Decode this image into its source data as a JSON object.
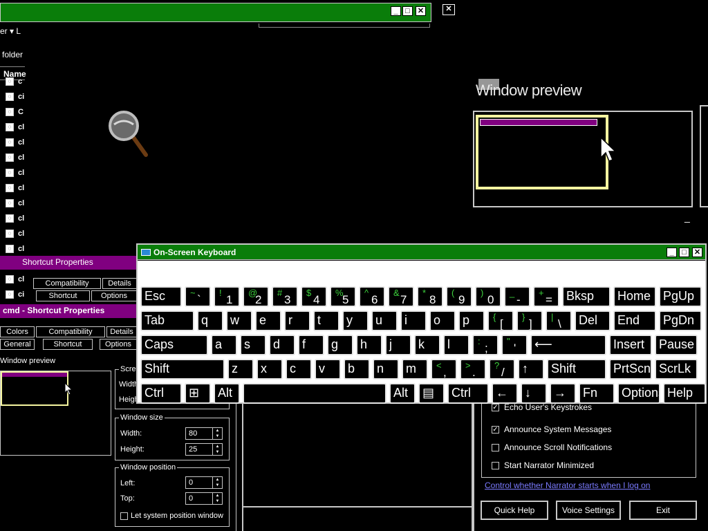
{
  "explorer": {
    "toolbar_text": "er ▾  L",
    "folder_label": "folder",
    "column_name": "Name",
    "file_items": [
      "c",
      "ci",
      "C",
      "cl",
      "cl",
      "cl",
      "cl",
      "cl",
      "cl",
      "cl",
      "cl",
      "cl",
      "cl",
      "cl",
      "ci"
    ]
  },
  "magnifier_preview": {
    "title": "Window preview",
    "min_label": "_"
  },
  "props1": {
    "title": "Shortcut Properties",
    "tabs_row1": [
      "Compatibility",
      "Details"
    ],
    "tabs_row2": [
      "Shortcut",
      "Options"
    ]
  },
  "props2": {
    "title": "cmd - Shortcut Properties",
    "tabs_row1": [
      "Colors",
      "Compatibility",
      "Details"
    ],
    "tabs_row2": [
      "General",
      "Shortcut",
      "Options"
    ],
    "preview_label": "Window preview",
    "screen_group": "Scre",
    "screen_width_label": "Width",
    "screen_height_label": "Height",
    "window_size": {
      "label": "Window size",
      "width_label": "Width:",
      "width_value": "80",
      "height_label": "Height:",
      "height_value": "25"
    },
    "window_position": {
      "label": "Window position",
      "left_label": "Left:",
      "left_value": "0",
      "top_label": "Top:",
      "top_value": "0",
      "let_system": "Let system position window"
    }
  },
  "osk": {
    "title": "On-Screen Keyboard",
    "rows": [
      [
        {
          "main": "Esc",
          "w": 60
        },
        {
          "shift": "~",
          "low": "`",
          "w": 38
        },
        {
          "shift": "!",
          "low": "1",
          "w": 38
        },
        {
          "shift": "@",
          "low": "2",
          "w": 38
        },
        {
          "shift": "#",
          "low": "3",
          "w": 38
        },
        {
          "shift": "$",
          "low": "4",
          "w": 38
        },
        {
          "shift": "%",
          "low": "5",
          "w": 38
        },
        {
          "shift": "^",
          "low": "6",
          "w": 38
        },
        {
          "shift": "&",
          "low": "7",
          "w": 38
        },
        {
          "shift": "*",
          "low": "8",
          "w": 38
        },
        {
          "shift": "(",
          "low": "9",
          "w": 38
        },
        {
          "shift": ")",
          "low": "0",
          "w": 38
        },
        {
          "shift": "_",
          "low": "-",
          "w": 38
        },
        {
          "shift": "+",
          "low": "=",
          "w": 38
        },
        {
          "main": "Bksp",
          "w": 70
        },
        {
          "main": "Home",
          "w": 62
        },
        {
          "main": "PgUp",
          "w": 62
        }
      ],
      [
        {
          "main": "Tab",
          "w": 78
        },
        {
          "main": "q",
          "w": 38
        },
        {
          "main": "w",
          "w": 38
        },
        {
          "main": "e",
          "w": 38
        },
        {
          "main": "r",
          "w": 38
        },
        {
          "main": "t",
          "w": 38
        },
        {
          "main": "y",
          "w": 38
        },
        {
          "main": "u",
          "w": 38
        },
        {
          "main": "i",
          "w": 38
        },
        {
          "main": "o",
          "w": 38
        },
        {
          "main": "p",
          "w": 38
        },
        {
          "shift": "{",
          "low": "[",
          "w": 38
        },
        {
          "shift": "}",
          "low": "]",
          "w": 38
        },
        {
          "shift": "|",
          "low": "\\",
          "w": 38
        },
        {
          "main": "Del",
          "w": 52
        },
        {
          "main": "End",
          "w": 62
        },
        {
          "main": "PgDn",
          "w": 62
        }
      ],
      [
        {
          "main": "Caps",
          "w": 98
        },
        {
          "main": "a",
          "w": 38
        },
        {
          "main": "s",
          "w": 38
        },
        {
          "main": "d",
          "w": 38
        },
        {
          "main": "f",
          "w": 38
        },
        {
          "main": "g",
          "w": 38
        },
        {
          "main": "h",
          "w": 38
        },
        {
          "main": "j",
          "w": 38
        },
        {
          "main": "k",
          "w": 38
        },
        {
          "main": "l",
          "w": 38
        },
        {
          "shift": ":",
          "low": ";",
          "w": 38
        },
        {
          "shift": "\"",
          "low": "'",
          "w": 38
        },
        {
          "main": "⟵",
          "w": 110
        },
        {
          "main": "Insert",
          "w": 62
        },
        {
          "main": "Pause",
          "w": 62
        }
      ],
      [
        {
          "main": "Shift",
          "w": 122
        },
        {
          "main": "z",
          "w": 38
        },
        {
          "main": "x",
          "w": 38
        },
        {
          "main": "c",
          "w": 38
        },
        {
          "main": "v",
          "w": 38
        },
        {
          "main": "b",
          "w": 38
        },
        {
          "main": "n",
          "w": 38
        },
        {
          "main": "m",
          "w": 38
        },
        {
          "shift": "<",
          "low": ",",
          "w": 38
        },
        {
          "shift": ">",
          "low": ".",
          "w": 38
        },
        {
          "shift": "?",
          "low": "/",
          "w": 38
        },
        {
          "main": "↑",
          "w": 38
        },
        {
          "main": "Shift",
          "w": 86
        },
        {
          "main": "PrtScn",
          "w": 62
        },
        {
          "main": "ScrLk",
          "w": 62
        }
      ],
      [
        {
          "main": "Ctrl",
          "w": 60
        },
        {
          "main": "⊞",
          "w": 38
        },
        {
          "main": "Alt",
          "w": 38
        },
        {
          "main": " ",
          "w": 208
        },
        {
          "main": "Alt",
          "w": 38
        },
        {
          "main": "▤",
          "w": 38
        },
        {
          "main": "Ctrl",
          "w": 60
        },
        {
          "main": "←",
          "w": 38
        },
        {
          "main": "↓",
          "w": 38
        },
        {
          "main": "→",
          "w": 38
        },
        {
          "main": "Fn",
          "w": 52
        },
        {
          "main": "Options",
          "w": 62
        },
        {
          "main": "Help",
          "w": 62
        }
      ]
    ]
  },
  "narrator": {
    "checkboxes": [
      {
        "label": "Echo User's Keystrokes",
        "checked": true
      },
      {
        "label": "Announce System Messages",
        "checked": true
      },
      {
        "label": "Announce Scroll Notifications",
        "checked": false
      },
      {
        "label": "Start Narrator Minimized",
        "checked": false
      }
    ],
    "link": "Control whether Narrator starts when I log on",
    "buttons": [
      "Quick Help",
      "Voice Settings",
      "Exit"
    ]
  },
  "colors": {
    "titlebar_green": "#0a7d0a",
    "title_purple": "#800080",
    "highlight_yellow": "#f5f5a0",
    "osk_shift_green": "#3cd23c",
    "link_blue": "#7b7bff"
  }
}
